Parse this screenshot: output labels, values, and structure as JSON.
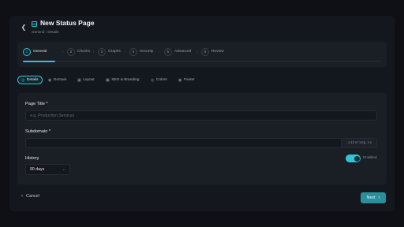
{
  "header": {
    "title": "New Status Page",
    "breadcrumb": "General › Details",
    "back_icon": "chevron-left-icon",
    "page_icon": "window-icon"
  },
  "steps": [
    {
      "num": "1",
      "label": "General",
      "active": true
    },
    {
      "num": "2",
      "label": "Checks"
    },
    {
      "num": "3",
      "label": "Graphs"
    },
    {
      "num": "4",
      "label": "Security"
    },
    {
      "num": "5",
      "label": "Advanced"
    },
    {
      "num": "6",
      "label": "Review"
    }
  ],
  "step_progress_fraction": 0.09,
  "tabs": [
    {
      "label": "Details",
      "icon": "circle-icon",
      "active": true
    },
    {
      "label": "Domain",
      "icon": "globe-icon"
    },
    {
      "label": "Layout",
      "icon": "layout-icon"
    },
    {
      "label": "SEO & Branding",
      "icon": "image-icon"
    },
    {
      "label": "Colors",
      "icon": "palette-icon"
    },
    {
      "label": "Footer",
      "icon": "footer-icon"
    }
  ],
  "form": {
    "page_title_label": "Page Title *",
    "page_title_placeholder": "e.g. Production Services",
    "page_title_value": "",
    "subdomain_label": "Subdomain *",
    "subdomain_value": "",
    "subdomain_suffix": ".xitoring.io",
    "history_label": "History",
    "history_value": "90 days",
    "history_enabled": true,
    "history_toggle_label": "Enabled"
  },
  "footer": {
    "cancel_label": "Cancel",
    "next_label": "Next"
  },
  "colors": {
    "accent": "#2fc4d6",
    "background": "#0e1015",
    "panel": "#1a1e25",
    "next_button": "#2a8f9a"
  }
}
